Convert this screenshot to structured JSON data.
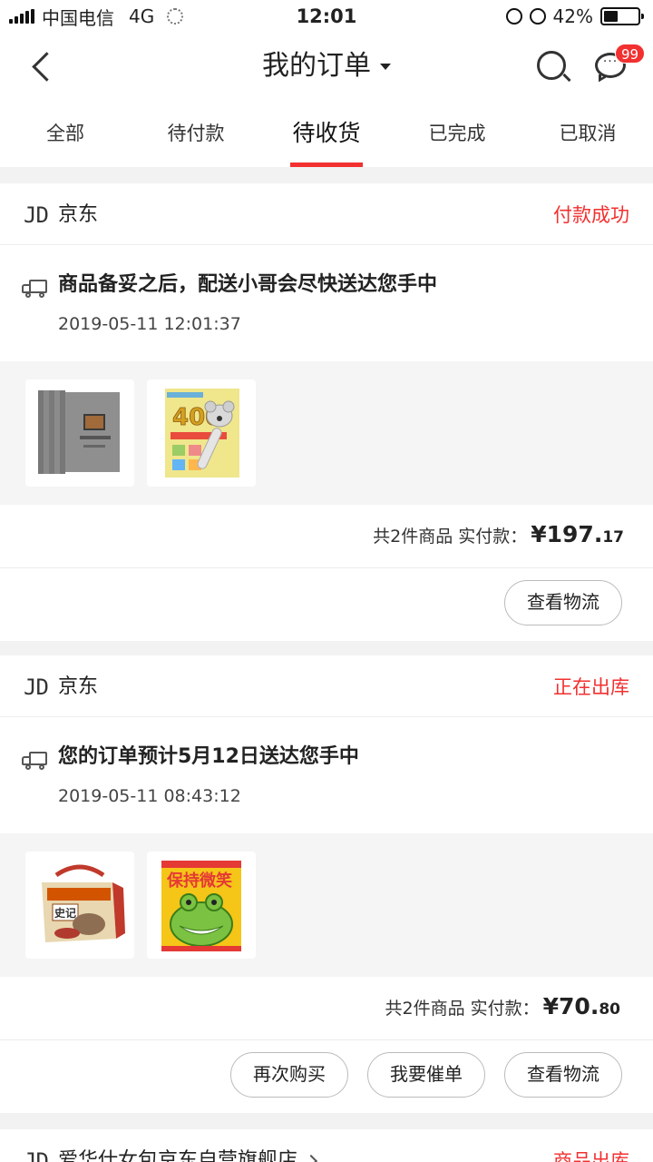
{
  "status_bar": {
    "carrier": "中国电信",
    "network": "4G",
    "time": "12:01",
    "battery": "42%",
    "battery_level": 0.42
  },
  "header": {
    "title": "我的订单",
    "badge": "99"
  },
  "tabs": [
    {
      "label": "全部"
    },
    {
      "label": "待付款"
    },
    {
      "label": "待收货",
      "active": true
    },
    {
      "label": "已完成"
    },
    {
      "label": "已取消"
    }
  ],
  "orders": [
    {
      "logo": "JD",
      "store": "京东",
      "status": "付款成功",
      "tracking_message": "商品备妥之后，配送小哥会尽快送达您手中",
      "tracking_time": "2019-05-11 12:01:37",
      "item_count": "共2件商品",
      "paid_label": "实付款：",
      "price_symbol": "¥",
      "price_int": "197.",
      "price_dec": "17",
      "buttons": {
        "logistics": "查看物流"
      }
    },
    {
      "logo": "JD",
      "store": "京东",
      "status": "正在出库",
      "tracking_message": "您的订单预计5月12日送达您手中",
      "tracking_time": "2019-05-11 08:43:12",
      "item_count": "共2件商品",
      "paid_label": "实付款：",
      "price_symbol": "¥",
      "price_int": "70.",
      "price_dec": "80",
      "buttons": {
        "buy_again": "再次购买",
        "remind": "我要催单",
        "logistics": "查看物流"
      }
    },
    {
      "logo": "JD",
      "store": "爱华仕女包京东自营旗舰店",
      "status": "商品出库"
    }
  ],
  "colors": {
    "accent": "#f23030",
    "background": "#f2f2f2"
  }
}
